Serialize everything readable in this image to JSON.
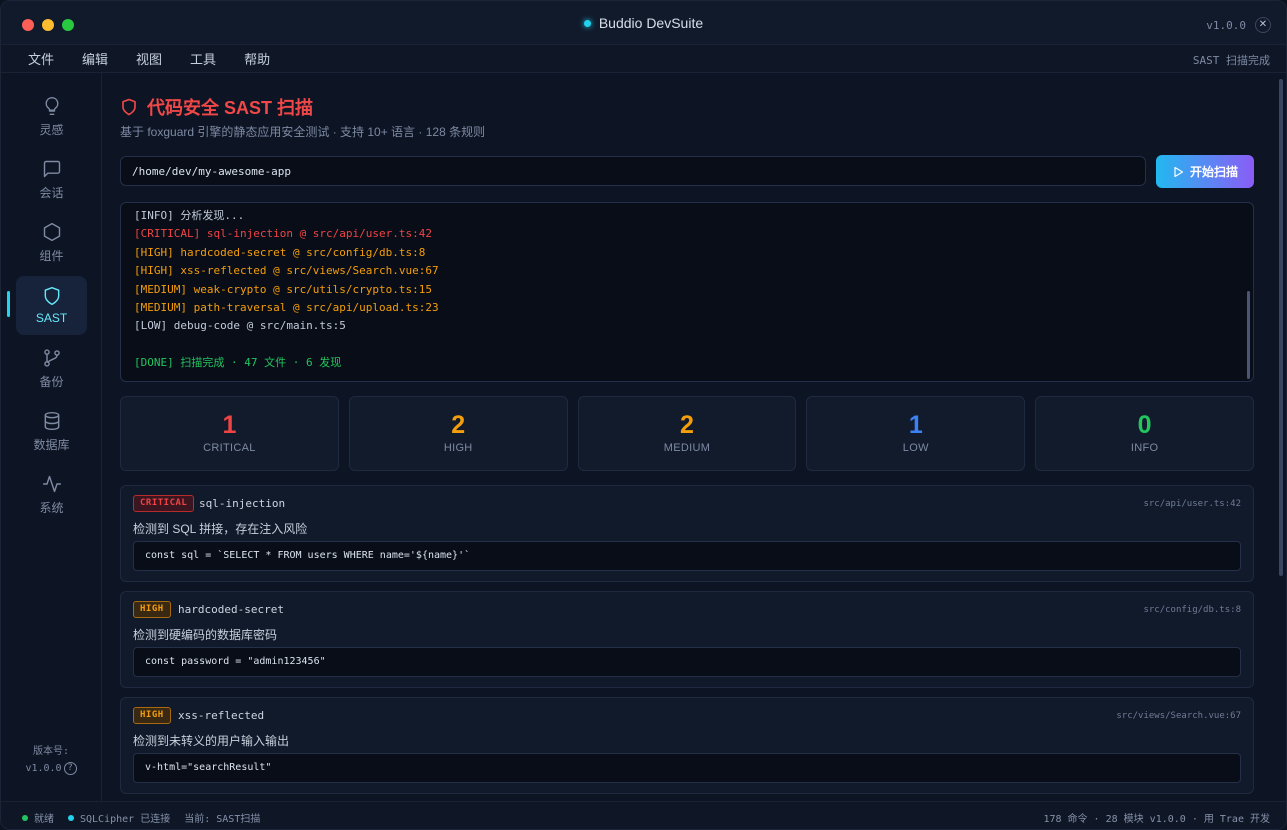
{
  "window": {
    "title": "Buddio DevSuite",
    "version": "v1.0.0",
    "close_glyph": "✕"
  },
  "menu": {
    "items": [
      "文件",
      "编辑",
      "视图",
      "工具",
      "帮助"
    ],
    "status": "SAST 扫描完成"
  },
  "sidebar": {
    "items": [
      {
        "label": "灵感",
        "icon": "lightbulb-icon"
      },
      {
        "label": "会话",
        "icon": "chat-icon"
      },
      {
        "label": "组件",
        "icon": "hexagon-icon"
      },
      {
        "label": "SAST",
        "icon": "shield-icon"
      },
      {
        "label": "备份",
        "icon": "git-branch-icon"
      },
      {
        "label": "数据库",
        "icon": "database-icon"
      },
      {
        "label": "系统",
        "icon": "activity-icon"
      }
    ],
    "active_index": 3,
    "version_label": "版本号:",
    "version_value": "v1.0.0",
    "help_glyph": "?"
  },
  "header": {
    "title": "代码安全 SAST 扫描",
    "subtitle": "基于 foxguard 引擎的静态应用安全测试 · 支持 10+ 语言 · 128 条规则"
  },
  "scan": {
    "path": "/home/dev/my-awesome-app",
    "button_label": "开始扫描"
  },
  "console": {
    "lines": [
      {
        "text": "[INFO] 分析发现...",
        "level": "info"
      },
      {
        "text": "[CRITICAL] sql-injection @ src/api/user.ts:42",
        "level": "critical"
      },
      {
        "text": "[HIGH] hardcoded-secret @ src/config/db.ts:8",
        "level": "high"
      },
      {
        "text": "[HIGH] xss-reflected @ src/views/Search.vue:67",
        "level": "high"
      },
      {
        "text": "[MEDIUM] weak-crypto @ src/utils/crypto.ts:15",
        "level": "medium"
      },
      {
        "text": "[MEDIUM] path-traversal @ src/api/upload.ts:23",
        "level": "medium"
      },
      {
        "text": "[LOW] debug-code @ src/main.ts:5",
        "level": "low"
      },
      {
        "text": "",
        "level": "info"
      },
      {
        "text": "[DONE] 扫描完成 · 47 文件 · 6 发现",
        "level": "done"
      }
    ]
  },
  "stats": [
    {
      "count": "1",
      "label": "CRITICAL",
      "color": "#ef4444"
    },
    {
      "count": "2",
      "label": "HIGH",
      "color": "#f59e0b"
    },
    {
      "count": "2",
      "label": "MEDIUM",
      "color": "#f59e0b"
    },
    {
      "count": "1",
      "label": "LOW",
      "color": "#3b82f6"
    },
    {
      "count": "0",
      "label": "INFO",
      "color": "#22c55e"
    }
  ],
  "findings": [
    {
      "severity": "CRITICAL",
      "rule": "sql-injection",
      "location": "src/api/user.ts:42",
      "description": "检测到 SQL 拼接，存在注入风险",
      "code": "const sql = `SELECT * FROM users WHERE name='${name}'`"
    },
    {
      "severity": "HIGH",
      "rule": "hardcoded-secret",
      "location": "src/config/db.ts:8",
      "description": "检测到硬编码的数据库密码",
      "code": "const password = \"admin123456\""
    },
    {
      "severity": "HIGH",
      "rule": "xss-reflected",
      "location": "src/views/Search.vue:67",
      "description": "检测到未转义的用户输入输出",
      "code": "v-html=\"searchResult\""
    }
  ],
  "statusbar": {
    "ready": "就绪",
    "db": "SQLCipher 已连接",
    "current": "当前: SAST扫描",
    "right": "178 命令 · 28 模块  v1.0.0 · 用 Trae 开发",
    "ready_color": "#22c55e",
    "db_color": "#22d3ee"
  }
}
